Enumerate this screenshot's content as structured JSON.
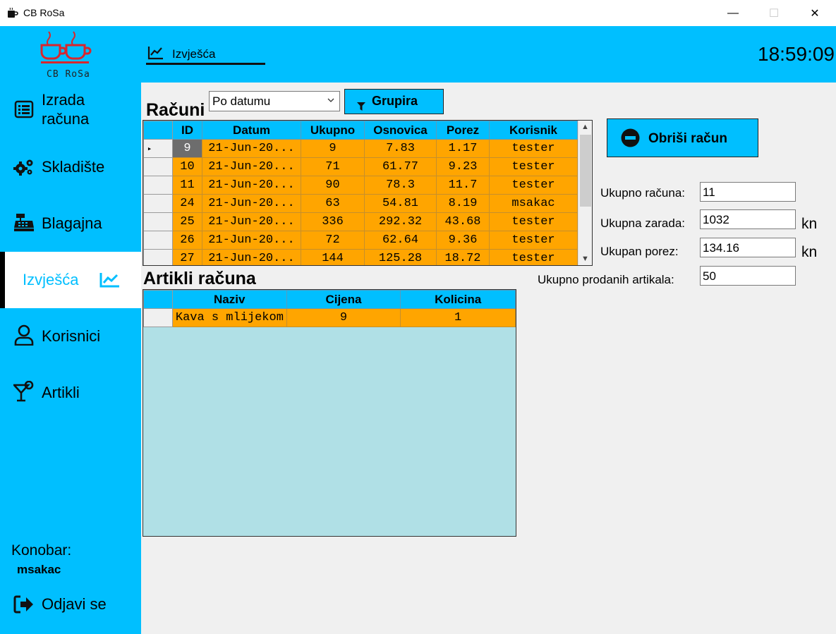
{
  "window": {
    "title": "CB RoSa",
    "min": "—",
    "max": "☐",
    "close": "✕"
  },
  "logo": {
    "text": "CB RoSa"
  },
  "header": {
    "tab_label": "Izvješća",
    "clock": "18:59:09"
  },
  "sidebar": {
    "items": [
      {
        "label_1": "Izrada",
        "label_2": "računa"
      },
      {
        "label": "Skladište"
      },
      {
        "label": "Blagajna"
      },
      {
        "label": "Izvješća"
      },
      {
        "label": "Korisnici"
      },
      {
        "label": "Artikli"
      }
    ],
    "konobar_label": "Konobar:",
    "konobar_user": "msakac",
    "logout": "Odjavi se"
  },
  "filter": {
    "selected": "Po datumu",
    "group_button": "Grupira"
  },
  "racuni": {
    "heading": "Računi",
    "columns": [
      "ID",
      "Datum",
      "Ukupno",
      "Osnovica",
      "Porez",
      "Korisnik"
    ],
    "rows": [
      [
        "9",
        "21-Jun-20...",
        "9",
        "7.83",
        "1.17",
        "tester"
      ],
      [
        "10",
        "21-Jun-20...",
        "71",
        "61.77",
        "9.23",
        "tester"
      ],
      [
        "11",
        "21-Jun-20...",
        "90",
        "78.3",
        "11.7",
        "tester"
      ],
      [
        "24",
        "21-Jun-20...",
        "63",
        "54.81",
        "8.19",
        "msakac"
      ],
      [
        "25",
        "21-Jun-20...",
        "336",
        "292.32",
        "43.68",
        "tester"
      ],
      [
        "26",
        "21-Jun-20...",
        "72",
        "62.64",
        "9.36",
        "tester"
      ],
      [
        "27",
        "21-Jun-20...",
        "144",
        "125.28",
        "18.72",
        "tester"
      ]
    ]
  },
  "artikli": {
    "heading": "Artikli računa",
    "columns": [
      "Naziv",
      "Cijena",
      "Kolicina"
    ],
    "rows": [
      [
        "Kava s mlijekom",
        "9",
        "1"
      ]
    ]
  },
  "actions": {
    "delete_button": "Obriši račun"
  },
  "stats": {
    "ukupno_racuna_label": "Ukupno računa:",
    "ukupno_racuna": "11",
    "ukupna_zarada_label": "Ukupna zarada:",
    "ukupna_zarada": "1032",
    "ukupan_porez_label": "Ukupan porez:",
    "ukupan_porez": "134.16",
    "prodanih_label": "Ukupno prodanih artikala:",
    "prodanih": "50",
    "currency": "kn"
  },
  "colors": {
    "accent": "#00bfff",
    "row": "#ffa500",
    "grid_bg": "#b0e0e6",
    "logo": "#d9262d"
  }
}
